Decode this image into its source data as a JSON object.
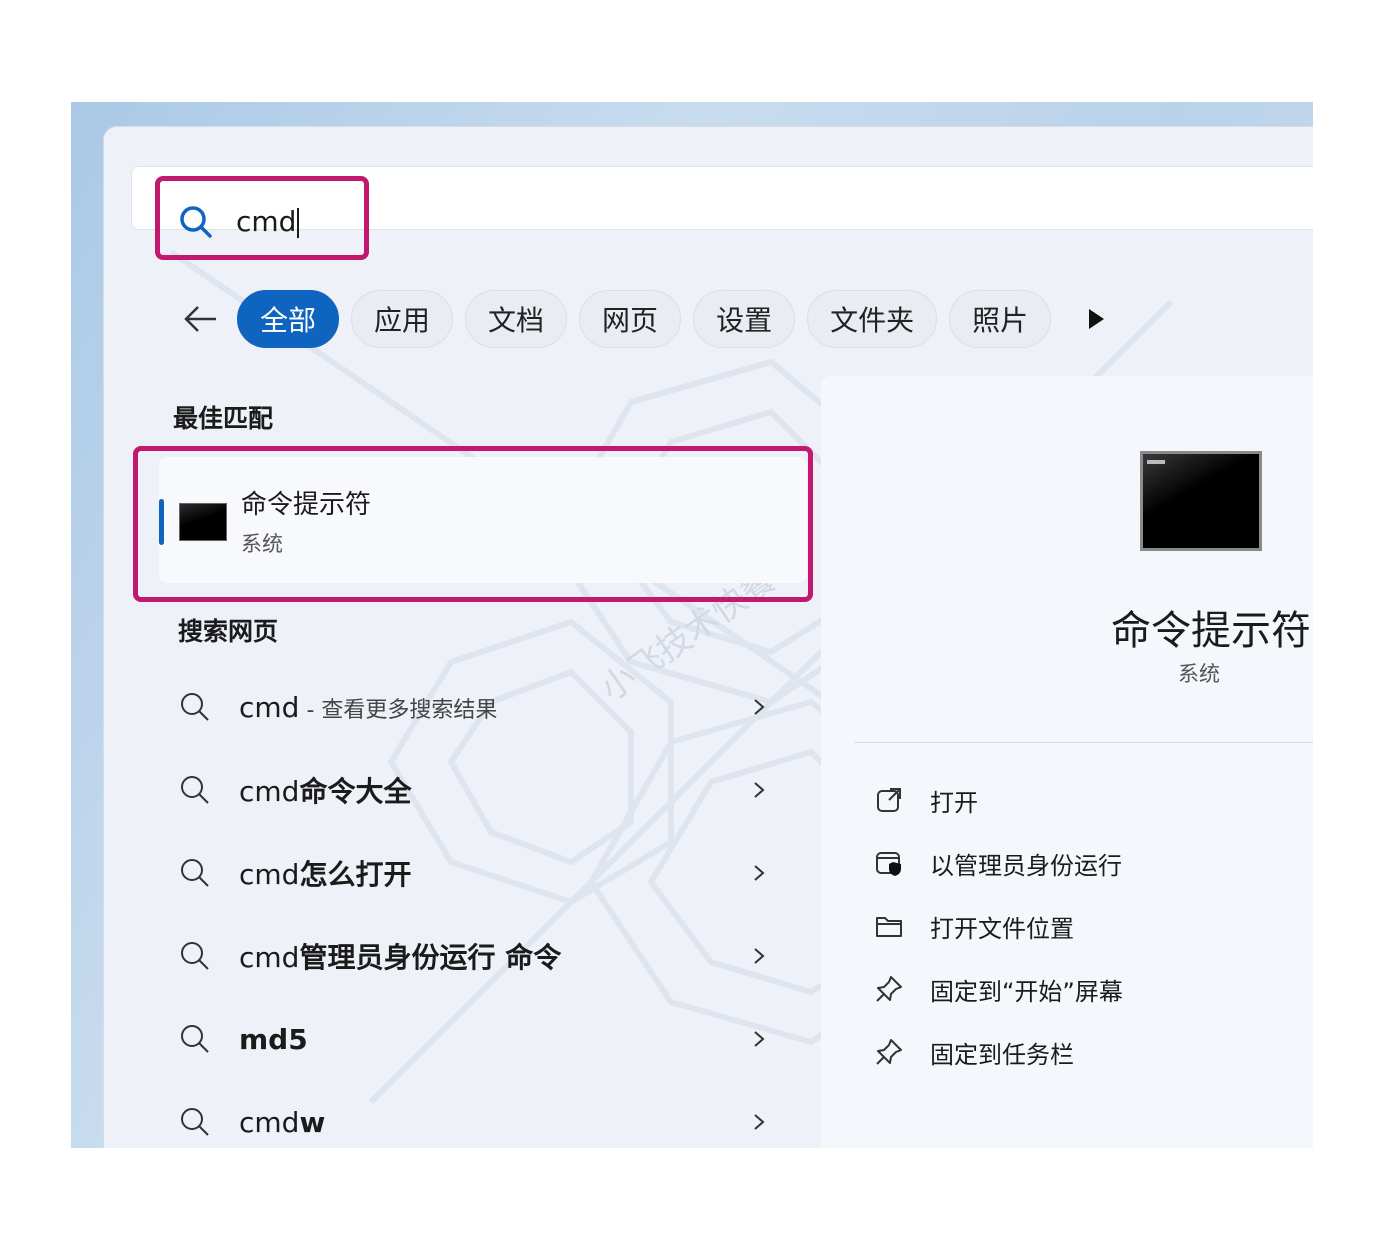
{
  "search": {
    "query": "cmd"
  },
  "filters": [
    "全部",
    "应用",
    "文档",
    "网页",
    "设置",
    "文件夹",
    "照片"
  ],
  "best_match": {
    "heading": "最佳匹配",
    "name": "命令提示符",
    "type": "系统"
  },
  "web_search": {
    "heading": "搜索网页",
    "items": [
      {
        "plain": "cmd",
        "bold": "",
        "suffix": " - 查看更多搜索结果"
      },
      {
        "plain": "cmd",
        "bold": "命令大全",
        "suffix": ""
      },
      {
        "plain": "cmd",
        "bold": "怎么打开",
        "suffix": ""
      },
      {
        "plain": "cmd",
        "bold": "管理员身份运行 命令",
        "suffix": ""
      },
      {
        "plain": "",
        "bold": "md5",
        "suffix": ""
      },
      {
        "plain": "cmd",
        "bold": "w",
        "suffix": ""
      }
    ]
  },
  "preview": {
    "name": "命令提示符",
    "type": "系统",
    "actions": [
      {
        "label": "打开",
        "icon": "open-external-icon"
      },
      {
        "label": "以管理员身份运行",
        "icon": "shield-run-admin-icon"
      },
      {
        "label": "打开文件位置",
        "icon": "folder-icon"
      },
      {
        "label": "固定到“开始”屏幕",
        "icon": "pin-icon"
      },
      {
        "label": "固定到任务栏",
        "icon": "pin-icon"
      }
    ]
  },
  "watermark": "小飞技术快餐",
  "colors": {
    "accent": "#0f64c0",
    "highlight": "#c2186e"
  }
}
